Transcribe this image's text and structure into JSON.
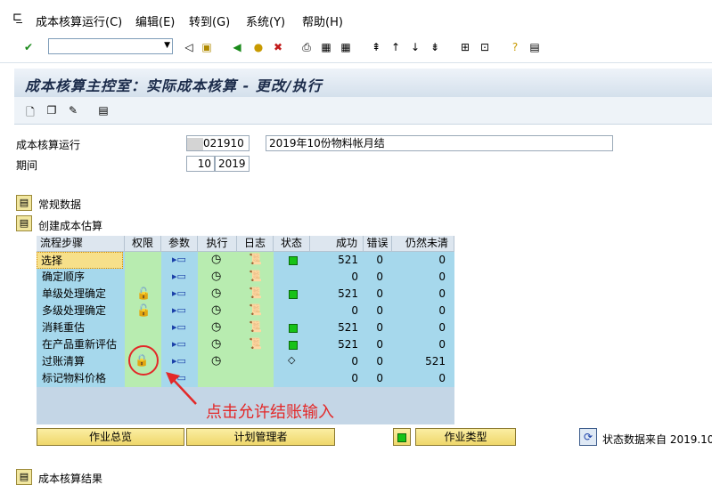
{
  "menu": {
    "items": [
      "成本核算运行(C)",
      "编辑(E)",
      "转到(G)",
      "系统(Y)",
      "帮助(H)"
    ]
  },
  "page": {
    "title": "成本核算主控室：实际成本核算 - 更改/执行"
  },
  "form": {
    "costing_run_label": "成本核算运行",
    "costing_run_id": "021910",
    "costing_run_desc": "2019年10份物料帐月结",
    "period_label": "期间",
    "period_month": "10",
    "period_year": "2019"
  },
  "sections": {
    "general_data": "常规数据",
    "create_estimate": "创建成本估算",
    "results": "成本核算结果"
  },
  "table": {
    "headers": {
      "step": "流程步骤",
      "auth": "权限",
      "params": "参数",
      "execute": "执行",
      "log": "日志",
      "status": "状态",
      "success": "成功",
      "errors": "错误",
      "open": "仍然未清"
    },
    "rows": [
      {
        "step": "选择",
        "success": "521",
        "errors": "0",
        "open": "0"
      },
      {
        "step": "确定顺序",
        "success": "0",
        "errors": "0",
        "open": "0"
      },
      {
        "step": "单级处理确定",
        "success": "521",
        "errors": "0",
        "open": "0"
      },
      {
        "step": "多级处理确定",
        "success": "0",
        "errors": "0",
        "open": "0"
      },
      {
        "step": "消耗重估",
        "success": "521",
        "errors": "0",
        "open": "0"
      },
      {
        "step": "在产品重新评估",
        "success": "521",
        "errors": "0",
        "open": "0"
      },
      {
        "step": "过账清算",
        "success": "0",
        "errors": "0",
        "open": "521"
      },
      {
        "step": "标记物料价格",
        "success": "0",
        "errors": "0",
        "open": "0"
      }
    ]
  },
  "buttons": {
    "job_overview": "作业总览",
    "plan_manager": "计划管理者",
    "job_type": "作业类型"
  },
  "status_source": "状态数据来自 2019.10",
  "annotation": "点击允许结账输入",
  "colors": {
    "accent_red": "#e32828",
    "grid_blue": "#a6d8ec",
    "grid_green": "#b8ecb0",
    "selection": "#f7e08a"
  }
}
